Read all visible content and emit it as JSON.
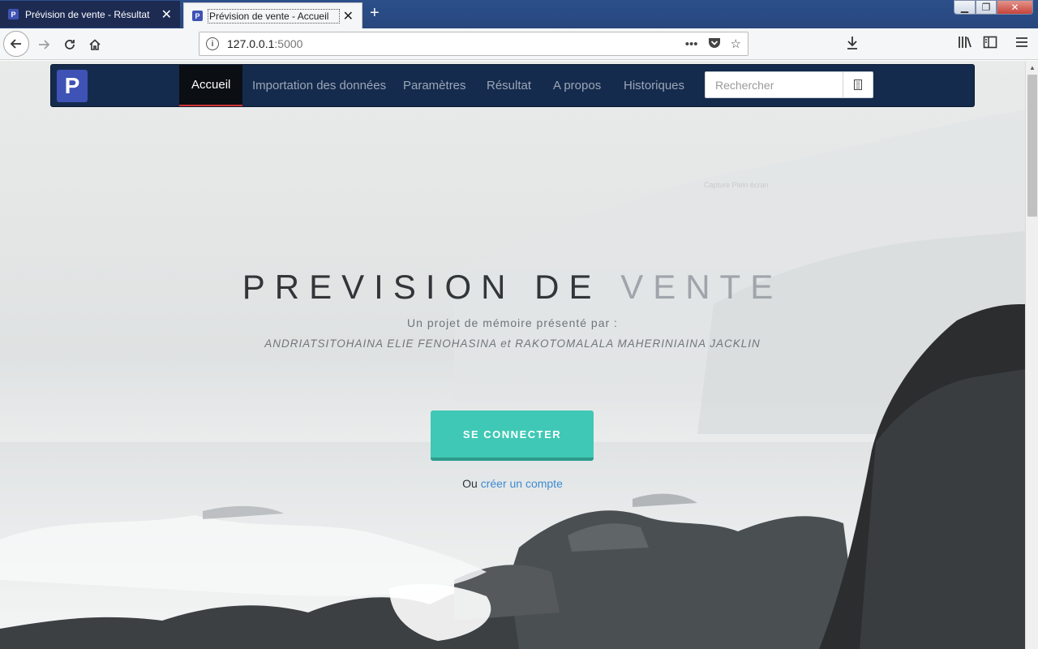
{
  "browser": {
    "tabs": [
      {
        "title": "Prévision de vente - Résultat",
        "favicon": "P",
        "active": false
      },
      {
        "title": "Prévision de vente - Accueil",
        "favicon": "P",
        "active": true
      }
    ],
    "new_tab_icon": "+",
    "window_controls": {
      "minimize": "▁",
      "maximize": "❐",
      "close": "✕"
    },
    "url_host": "127.0.0.1",
    "url_port": ":5000",
    "icons": {
      "back": "back-arrow-icon",
      "forward": "forward-arrow-icon",
      "reload": "reload-icon",
      "home": "home-icon",
      "info": "info-icon",
      "page_actions": "more-dots-icon",
      "pocket": "pocket-icon",
      "bookmark": "star-icon",
      "download": "download-icon",
      "library": "library-icon",
      "sidebar": "sidebar-icon",
      "menu": "hamburger-menu-icon"
    }
  },
  "site": {
    "logo_letter": "P",
    "nav": [
      {
        "label": "Accueil",
        "active": true
      },
      {
        "label": "Importation des données",
        "active": false
      },
      {
        "label": "Paramètres",
        "active": false
      },
      {
        "label": "Résultat",
        "active": false
      },
      {
        "label": "A propos",
        "active": false
      },
      {
        "label": "Historiques",
        "active": false
      }
    ],
    "search_placeholder": "Rechercher",
    "search_icon": "search-button-icon"
  },
  "hero": {
    "watermark": "Capture Plein écran",
    "title_dark": "PREVISION DE ",
    "title_light": "VENTE",
    "subtitle": "Un projet de mémoire présenté par :",
    "authors": "ANDRIATSITOHAINA ELIE FENOHASINA et RAKOTOMALALA MAHERINIAINA JACKLIN",
    "cta_label": "SE CONNECTER",
    "register_prefix": "Ou",
    "register_link": "créer un compte"
  },
  "colors": {
    "site_nav_bg": "#152b4d",
    "logo_bg": "#3f52b5",
    "active_indicator": "#d23333",
    "cta": "#3fc8b5",
    "link": "#3c8bd1"
  }
}
